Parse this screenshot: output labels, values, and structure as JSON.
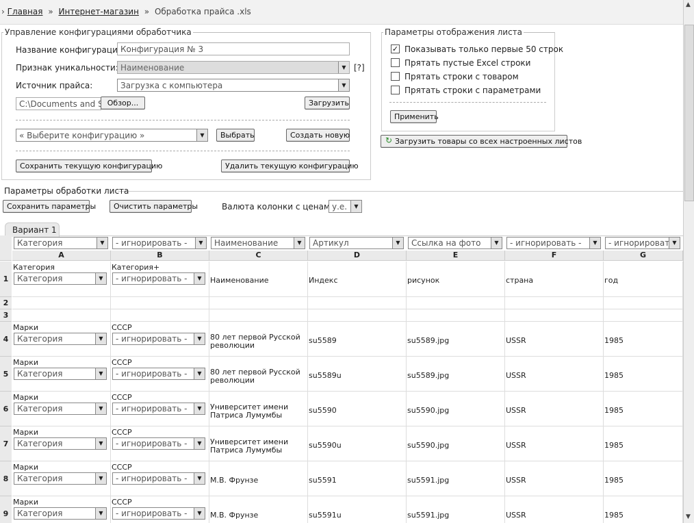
{
  "breadcrumb": {
    "items": [
      "Главная",
      "Интернет-магазин"
    ],
    "current": "Обработка прайса .xls",
    "separator": "»"
  },
  "config": {
    "legend": "Управление конфигурациями обработчика",
    "name_label": "Название конфигурации:",
    "name_value": "Конфигурация № 3",
    "unique_label": "Признак уникальности:",
    "unique_value": "Наименование",
    "unique_help": "[?]",
    "source_label": "Источник прайса:",
    "source_value": "Загрузка с компьютера",
    "file_value": "C:\\Documents and Se",
    "browse_label": "Обзор...",
    "upload_label": "Загрузить",
    "choose_placeholder": "« Выберите конфигурацию »",
    "choose_label": "Выбрать",
    "create_label": "Создать новую",
    "save_label": "Сохранить текущую конфигурацию",
    "delete_label": "Удалить текущую конфигурацию"
  },
  "display": {
    "legend": "Параметры отображения листа",
    "options": [
      {
        "label": "Показывать только первые 50 строк",
        "checked": true
      },
      {
        "label": "Прятать пустые Excel строки",
        "checked": false
      },
      {
        "label": "Прятать строки с товаром",
        "checked": false
      },
      {
        "label": "Прятать строки с параметрами",
        "checked": false
      }
    ],
    "apply_label": "Применить",
    "load_all_label": "Загрузить товары со всех настроенных листов"
  },
  "sheet": {
    "legend": "Параметры обработки листа",
    "save_params_label": "Сохранить параметры",
    "clear_params_label": "Очистить параметры",
    "currency_label": "Валюта колонки с ценами:",
    "currency_value": "у.е.",
    "tab_label": "Вариант 1"
  },
  "grid": {
    "column_selects": [
      "Категория",
      "- игнорировать -",
      "Наименование",
      "Артикул",
      "Ссылка на фото",
      "- игнорировать -",
      "- игнорировать -"
    ],
    "column_letters": [
      "A",
      "B",
      "C",
      "D",
      "E",
      "F",
      "G"
    ],
    "rows": [
      {
        "num": "1",
        "a_top": "Категория",
        "a_sel": "Категория",
        "b_top": "Категория+",
        "b_sel": "- игнорировать -",
        "c": "Наименование",
        "d": "Индекс",
        "e": "рисунок",
        "f": "страна",
        "g": "год"
      },
      {
        "num": "2"
      },
      {
        "num": "3"
      },
      {
        "num": "4",
        "a_top": "Марки",
        "a_sel": "Категория",
        "b_top": "СССР",
        "b_sel": "- игнорировать -",
        "c": "80 лет первой Русской революции",
        "d": "su5589",
        "e": "su5589.jpg",
        "f": "USSR",
        "g": "1985"
      },
      {
        "num": "5",
        "a_top": "Марки",
        "a_sel": "Категория",
        "b_top": "СССР",
        "b_sel": "- игнорировать -",
        "c": "80 лет первой Русской революции",
        "d": "su5589u",
        "e": "su5589.jpg",
        "f": "USSR",
        "g": "1985"
      },
      {
        "num": "6",
        "a_top": "Марки",
        "a_sel": "Категория",
        "b_top": "СССР",
        "b_sel": "- игнорировать -",
        "c": "Университет имени Патриса Лумумбы",
        "d": "su5590",
        "e": "su5590.jpg",
        "f": "USSR",
        "g": "1985"
      },
      {
        "num": "7",
        "a_top": "Марки",
        "a_sel": "Категория",
        "b_top": "СССР",
        "b_sel": "- игнорировать -",
        "c": "Университет имени Патриса Лумумбы",
        "d": "su5590u",
        "e": "su5590.jpg",
        "f": "USSR",
        "g": "1985"
      },
      {
        "num": "8",
        "a_top": "Марки",
        "a_sel": "Категория",
        "b_top": "СССР",
        "b_sel": "- игнорировать -",
        "c": "М.В. Фрунзе",
        "d": "su5591",
        "e": "su5591.jpg",
        "f": "USSR",
        "g": "1985"
      },
      {
        "num": "9",
        "a_top": "Марки",
        "a_sel": "Категория",
        "b_top": "СССР",
        "b_sel": "- игнорировать -",
        "c": "М.В. Фрунзе",
        "d": "su5591u",
        "e": "su5591.jpg",
        "f": "USSR",
        "g": "1985"
      }
    ]
  }
}
